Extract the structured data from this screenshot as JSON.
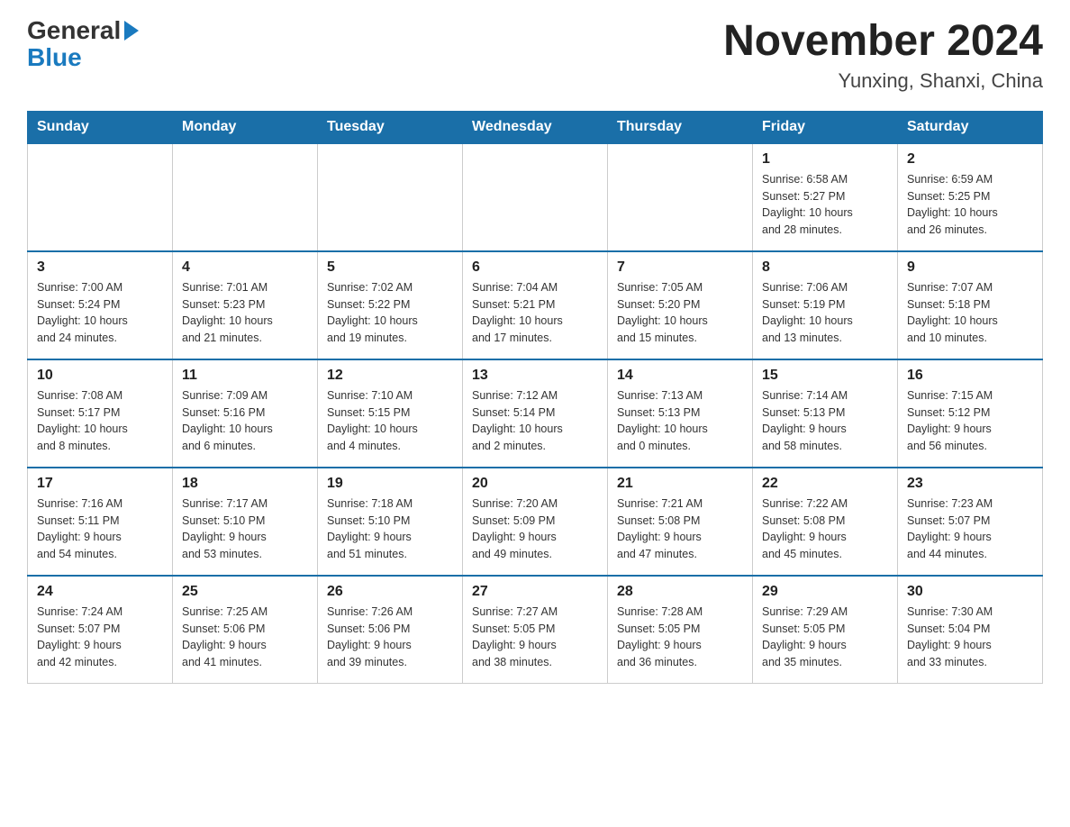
{
  "header": {
    "logo_general": "General",
    "logo_blue": "Blue",
    "month_title": "November 2024",
    "location": "Yunxing, Shanxi, China"
  },
  "weekdays": [
    "Sunday",
    "Monday",
    "Tuesday",
    "Wednesday",
    "Thursday",
    "Friday",
    "Saturday"
  ],
  "weeks": [
    [
      {
        "day": "",
        "info": ""
      },
      {
        "day": "",
        "info": ""
      },
      {
        "day": "",
        "info": ""
      },
      {
        "day": "",
        "info": ""
      },
      {
        "day": "",
        "info": ""
      },
      {
        "day": "1",
        "info": "Sunrise: 6:58 AM\nSunset: 5:27 PM\nDaylight: 10 hours\nand 28 minutes."
      },
      {
        "day": "2",
        "info": "Sunrise: 6:59 AM\nSunset: 5:25 PM\nDaylight: 10 hours\nand 26 minutes."
      }
    ],
    [
      {
        "day": "3",
        "info": "Sunrise: 7:00 AM\nSunset: 5:24 PM\nDaylight: 10 hours\nand 24 minutes."
      },
      {
        "day": "4",
        "info": "Sunrise: 7:01 AM\nSunset: 5:23 PM\nDaylight: 10 hours\nand 21 minutes."
      },
      {
        "day": "5",
        "info": "Sunrise: 7:02 AM\nSunset: 5:22 PM\nDaylight: 10 hours\nand 19 minutes."
      },
      {
        "day": "6",
        "info": "Sunrise: 7:04 AM\nSunset: 5:21 PM\nDaylight: 10 hours\nand 17 minutes."
      },
      {
        "day": "7",
        "info": "Sunrise: 7:05 AM\nSunset: 5:20 PM\nDaylight: 10 hours\nand 15 minutes."
      },
      {
        "day": "8",
        "info": "Sunrise: 7:06 AM\nSunset: 5:19 PM\nDaylight: 10 hours\nand 13 minutes."
      },
      {
        "day": "9",
        "info": "Sunrise: 7:07 AM\nSunset: 5:18 PM\nDaylight: 10 hours\nand 10 minutes."
      }
    ],
    [
      {
        "day": "10",
        "info": "Sunrise: 7:08 AM\nSunset: 5:17 PM\nDaylight: 10 hours\nand 8 minutes."
      },
      {
        "day": "11",
        "info": "Sunrise: 7:09 AM\nSunset: 5:16 PM\nDaylight: 10 hours\nand 6 minutes."
      },
      {
        "day": "12",
        "info": "Sunrise: 7:10 AM\nSunset: 5:15 PM\nDaylight: 10 hours\nand 4 minutes."
      },
      {
        "day": "13",
        "info": "Sunrise: 7:12 AM\nSunset: 5:14 PM\nDaylight: 10 hours\nand 2 minutes."
      },
      {
        "day": "14",
        "info": "Sunrise: 7:13 AM\nSunset: 5:13 PM\nDaylight: 10 hours\nand 0 minutes."
      },
      {
        "day": "15",
        "info": "Sunrise: 7:14 AM\nSunset: 5:13 PM\nDaylight: 9 hours\nand 58 minutes."
      },
      {
        "day": "16",
        "info": "Sunrise: 7:15 AM\nSunset: 5:12 PM\nDaylight: 9 hours\nand 56 minutes."
      }
    ],
    [
      {
        "day": "17",
        "info": "Sunrise: 7:16 AM\nSunset: 5:11 PM\nDaylight: 9 hours\nand 54 minutes."
      },
      {
        "day": "18",
        "info": "Sunrise: 7:17 AM\nSunset: 5:10 PM\nDaylight: 9 hours\nand 53 minutes."
      },
      {
        "day": "19",
        "info": "Sunrise: 7:18 AM\nSunset: 5:10 PM\nDaylight: 9 hours\nand 51 minutes."
      },
      {
        "day": "20",
        "info": "Sunrise: 7:20 AM\nSunset: 5:09 PM\nDaylight: 9 hours\nand 49 minutes."
      },
      {
        "day": "21",
        "info": "Sunrise: 7:21 AM\nSunset: 5:08 PM\nDaylight: 9 hours\nand 47 minutes."
      },
      {
        "day": "22",
        "info": "Sunrise: 7:22 AM\nSunset: 5:08 PM\nDaylight: 9 hours\nand 45 minutes."
      },
      {
        "day": "23",
        "info": "Sunrise: 7:23 AM\nSunset: 5:07 PM\nDaylight: 9 hours\nand 44 minutes."
      }
    ],
    [
      {
        "day": "24",
        "info": "Sunrise: 7:24 AM\nSunset: 5:07 PM\nDaylight: 9 hours\nand 42 minutes."
      },
      {
        "day": "25",
        "info": "Sunrise: 7:25 AM\nSunset: 5:06 PM\nDaylight: 9 hours\nand 41 minutes."
      },
      {
        "day": "26",
        "info": "Sunrise: 7:26 AM\nSunset: 5:06 PM\nDaylight: 9 hours\nand 39 minutes."
      },
      {
        "day": "27",
        "info": "Sunrise: 7:27 AM\nSunset: 5:05 PM\nDaylight: 9 hours\nand 38 minutes."
      },
      {
        "day": "28",
        "info": "Sunrise: 7:28 AM\nSunset: 5:05 PM\nDaylight: 9 hours\nand 36 minutes."
      },
      {
        "day": "29",
        "info": "Sunrise: 7:29 AM\nSunset: 5:05 PM\nDaylight: 9 hours\nand 35 minutes."
      },
      {
        "day": "30",
        "info": "Sunrise: 7:30 AM\nSunset: 5:04 PM\nDaylight: 9 hours\nand 33 minutes."
      }
    ]
  ]
}
